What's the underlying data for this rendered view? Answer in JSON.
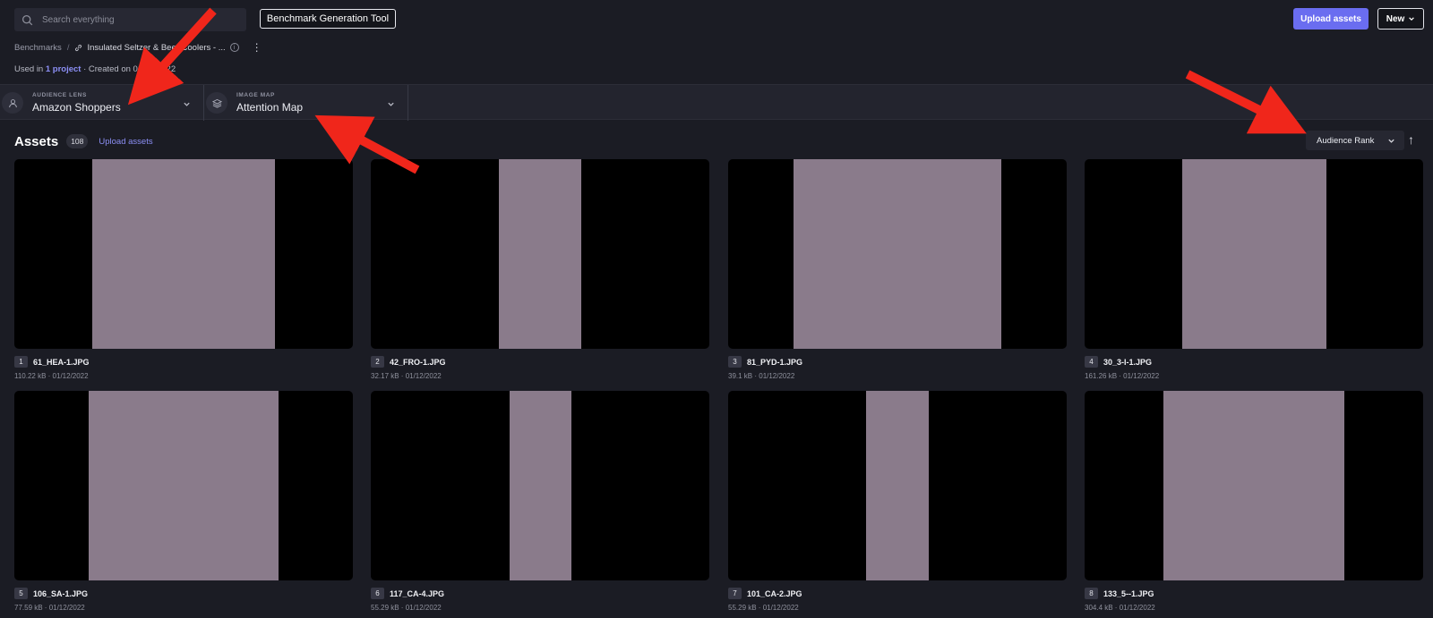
{
  "search": {
    "placeholder": "Search everything"
  },
  "toolbar": {
    "benchmark_tool_label": "Benchmark Generation Tool",
    "upload_label": "Upload assets",
    "new_label": "New"
  },
  "breadcrumb": {
    "root": "Benchmarks",
    "current": "Insulated Seltzer & Beer Coolers - ..."
  },
  "meta": {
    "used_in_prefix": "Used in",
    "project_link": "1 project",
    "created": "· Created on 01/12/2022"
  },
  "lenses": [
    {
      "label": "AUDIENCE LENS",
      "value": "Amazon Shoppers",
      "icon": "user-icon"
    },
    {
      "label": "IMAGE MAP",
      "value": "Attention Map",
      "icon": "layers-icon"
    }
  ],
  "assets": {
    "title": "Assets",
    "count": "108",
    "upload_link": "Upload assets",
    "sort_label": "Audience Rank",
    "sort_direction": "↑"
  },
  "cards": [
    {
      "num": "1",
      "name": "61_HEA-1.JPG",
      "meta": "110.22 kB · 01/12/2022"
    },
    {
      "num": "2",
      "name": "42_FRO-1.JPG",
      "meta": "32.17 kB · 01/12/2022"
    },
    {
      "num": "3",
      "name": "81_PYD-1.JPG",
      "meta": "39.1 kB · 01/12/2022"
    },
    {
      "num": "4",
      "name": "30_3-I-1.JPG",
      "meta": "161.26 kB · 01/12/2022"
    },
    {
      "num": "5",
      "name": "106_SA-1.JPG",
      "meta": "77.59 kB · 01/12/2022"
    },
    {
      "num": "6",
      "name": "117_CA-4.JPG",
      "meta": "55.29 kB · 01/12/2022"
    },
    {
      "num": "7",
      "name": "101_CA-2.JPG",
      "meta": "55.29 kB · 01/12/2022"
    },
    {
      "num": "8",
      "name": "133_5--1.JPG",
      "meta": "304.4 kB · 01/12/2022"
    }
  ],
  "colors": {
    "accent": "#6a6df0",
    "link": "#8c8ff5",
    "background": "#1b1c24",
    "panel": "#23242e"
  }
}
